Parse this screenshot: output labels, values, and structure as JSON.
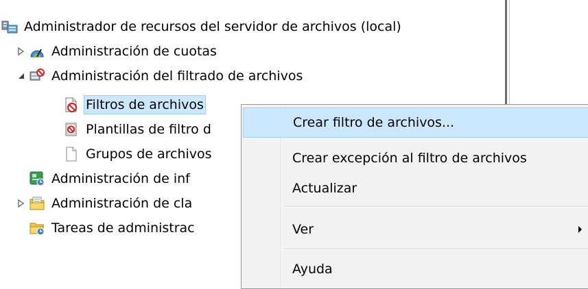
{
  "tree": {
    "root": {
      "label": "Administrador de recursos del servidor de archivos (local)"
    },
    "items": [
      {
        "label": "Administración de cuotas"
      },
      {
        "label": "Administración del filtrado de archivos"
      },
      {
        "label": "Filtros de archivos"
      },
      {
        "label": "Plantillas de filtro d"
      },
      {
        "label": "Grupos de archivos"
      },
      {
        "label": "Administración de inf"
      },
      {
        "label": "Administración de cla"
      },
      {
        "label": "Tareas de administrac"
      }
    ]
  },
  "context_menu": {
    "items": [
      {
        "label": "Crear filtro de archivos..."
      },
      {
        "label": "Crear excepción al filtro de archivos"
      },
      {
        "label": "Actualizar"
      },
      {
        "label": "Ver"
      },
      {
        "label": "Ayuda"
      }
    ]
  },
  "colors": {
    "selection": "#cce8ff",
    "selection_border": "#99d1ff",
    "menu_background": "#f2f2f2"
  }
}
